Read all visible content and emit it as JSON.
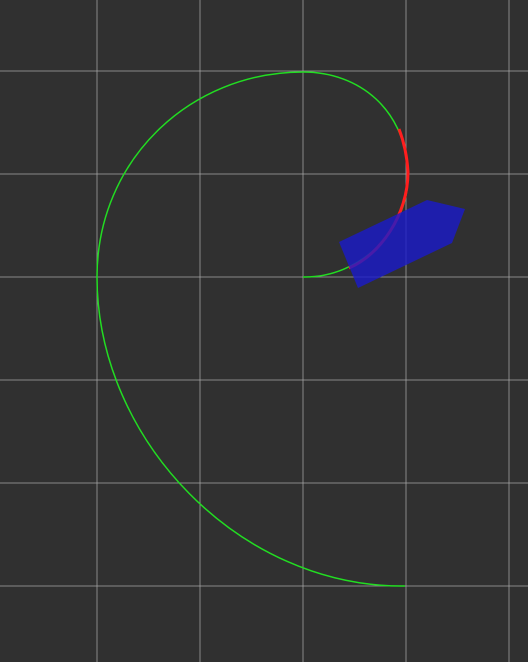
{
  "viewer": {
    "background_color": "#303030",
    "grid": {
      "visible": true,
      "color": "#a6a6a6",
      "spacing": 1,
      "columns": [
        -2,
        -1,
        0,
        1,
        2
      ],
      "rows": [
        -2,
        -1,
        0,
        1,
        2,
        3
      ]
    },
    "path": {
      "color": "#22dd22",
      "description_type": "spiral-trajectory"
    },
    "highlight_segment": {
      "color": "#ff1e1e"
    },
    "robot_marker": {
      "shape": "arrow",
      "color": "#1a1acc",
      "opacity": 0.8
    }
  }
}
